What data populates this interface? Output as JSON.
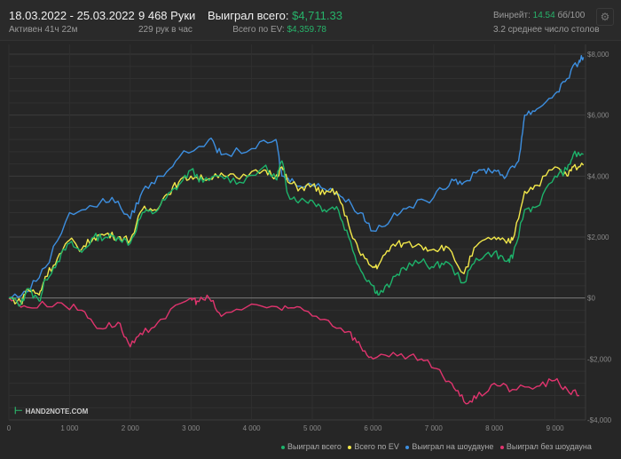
{
  "header": {
    "date_range": "18.03.2022 - 25.03.2022",
    "active": "Активен 41ч 22м",
    "hands": "9 468 Руки",
    "hands_per_hour": "229 рук в час",
    "won_label": "Выиграл всего:",
    "won_value": "$4,711.33",
    "ev_label": "Всего по EV:",
    "ev_value": "$4,359.78",
    "winrate_label": "Винрейт:",
    "winrate_value": "14.54",
    "winrate_unit": "бб/100",
    "avg_tables": "3.2 среднее число столов",
    "settings_icon": "gear-icon"
  },
  "logo": "HAND2NOTE.COM",
  "chart_data": {
    "type": "line",
    "title": "",
    "xlabel": "",
    "ylabel": "",
    "xlim": [
      0,
      9468
    ],
    "ylim": [
      -4000,
      8000
    ],
    "x_ticks": [
      0,
      1000,
      2000,
      3000,
      4000,
      5000,
      6000,
      7000,
      8000,
      9000
    ],
    "x_tick_labels": [
      "0",
      "1 000",
      "2 000",
      "3 000",
      "4 000",
      "5 000",
      "6 000",
      "7 000",
      "8 000",
      "9 000"
    ],
    "y_ticks": [
      8000,
      6000,
      4000,
      2000,
      0,
      -2000,
      -4000
    ],
    "y_tick_labels": [
      "$8,000",
      "$6,000",
      "$4,000",
      "$2,000",
      "$0",
      "-$2,000",
      "-$4,000"
    ],
    "grid": true,
    "legend_position": "bottom-right",
    "series": [
      {
        "name": "Выиграл всего",
        "color": "#1db36b",
        "points": [
          [
            0,
            0
          ],
          [
            200,
            -200
          ],
          [
            300,
            300
          ],
          [
            500,
            -100
          ],
          [
            600,
            600
          ],
          [
            800,
            1200
          ],
          [
            1000,
            1800
          ],
          [
            1200,
            1500
          ],
          [
            1400,
            2000
          ],
          [
            1600,
            2000
          ],
          [
            1800,
            2000
          ],
          [
            2000,
            1800
          ],
          [
            2200,
            2800
          ],
          [
            2400,
            2800
          ],
          [
            2600,
            3300
          ],
          [
            2800,
            3700
          ],
          [
            3000,
            4200
          ],
          [
            3200,
            3800
          ],
          [
            3500,
            4000
          ],
          [
            3800,
            3800
          ],
          [
            4200,
            4300
          ],
          [
            4400,
            3900
          ],
          [
            4500,
            4500
          ],
          [
            4600,
            3400
          ],
          [
            4800,
            3200
          ],
          [
            5000,
            3200
          ],
          [
            5200,
            2900
          ],
          [
            5400,
            3000
          ],
          [
            5600,
            2000
          ],
          [
            5800,
            900
          ],
          [
            6000,
            400
          ],
          [
            6100,
            100
          ],
          [
            6300,
            500
          ],
          [
            6500,
            1000
          ],
          [
            6800,
            1200
          ],
          [
            7000,
            1000
          ],
          [
            7200,
            1200
          ],
          [
            7500,
            500
          ],
          [
            7700,
            1300
          ],
          [
            8000,
            1500
          ],
          [
            8200,
            1200
          ],
          [
            8300,
            1300
          ],
          [
            8500,
            2900
          ],
          [
            8700,
            3000
          ],
          [
            9000,
            4000
          ],
          [
            9200,
            4200
          ],
          [
            9300,
            4700
          ],
          [
            9468,
            4711
          ]
        ]
      },
      {
        "name": "Всего по EV",
        "color": "#f2e84a",
        "points": [
          [
            0,
            0
          ],
          [
            200,
            -150
          ],
          [
            300,
            300
          ],
          [
            500,
            100
          ],
          [
            600,
            700
          ],
          [
            800,
            1300
          ],
          [
            1000,
            1900
          ],
          [
            1200,
            1600
          ],
          [
            1400,
            2000
          ],
          [
            1600,
            2100
          ],
          [
            1800,
            2000
          ],
          [
            2000,
            1900
          ],
          [
            2200,
            2900
          ],
          [
            2400,
            2900
          ],
          [
            2600,
            3400
          ],
          [
            2800,
            3800
          ],
          [
            3000,
            4000
          ],
          [
            3200,
            3900
          ],
          [
            3500,
            4100
          ],
          [
            3800,
            3900
          ],
          [
            4200,
            4200
          ],
          [
            4400,
            4000
          ],
          [
            4500,
            4300
          ],
          [
            4600,
            3800
          ],
          [
            4800,
            3600
          ],
          [
            5000,
            3700
          ],
          [
            5200,
            3400
          ],
          [
            5400,
            3500
          ],
          [
            5600,
            2400
          ],
          [
            5800,
            1400
          ],
          [
            6000,
            1000
          ],
          [
            6100,
            1100
          ],
          [
            6300,
            1700
          ],
          [
            6500,
            1800
          ],
          [
            6800,
            1700
          ],
          [
            7000,
            1600
          ],
          [
            7200,
            1700
          ],
          [
            7500,
            800
          ],
          [
            7700,
            1700
          ],
          [
            8000,
            2000
          ],
          [
            8200,
            1800
          ],
          [
            8300,
            1900
          ],
          [
            8500,
            3500
          ],
          [
            8700,
            3700
          ],
          [
            9000,
            4300
          ],
          [
            9200,
            4000
          ],
          [
            9300,
            4300
          ],
          [
            9468,
            4360
          ]
        ]
      },
      {
        "name": "Выиграл на шоудауне",
        "color": "#3d8fe0",
        "points": [
          [
            0,
            0
          ],
          [
            300,
            200
          ],
          [
            600,
            1000
          ],
          [
            1000,
            2800
          ],
          [
            1400,
            3000
          ],
          [
            1700,
            3300
          ],
          [
            2000,
            2600
          ],
          [
            2200,
            3500
          ],
          [
            2500,
            4000
          ],
          [
            2800,
            4600
          ],
          [
            3300,
            5200
          ],
          [
            3500,
            4700
          ],
          [
            4000,
            4900
          ],
          [
            4400,
            5200
          ],
          [
            4500,
            4000
          ],
          [
            4700,
            3800
          ],
          [
            5000,
            3700
          ],
          [
            5300,
            3600
          ],
          [
            5500,
            3300
          ],
          [
            5800,
            2800
          ],
          [
            6000,
            2200
          ],
          [
            6300,
            2600
          ],
          [
            6600,
            3000
          ],
          [
            7000,
            3300
          ],
          [
            7300,
            3900
          ],
          [
            7500,
            3800
          ],
          [
            7800,
            4200
          ],
          [
            8000,
            4200
          ],
          [
            8200,
            4000
          ],
          [
            8400,
            4500
          ],
          [
            8500,
            6000
          ],
          [
            8700,
            6200
          ],
          [
            9000,
            6700
          ],
          [
            9200,
            7200
          ],
          [
            9400,
            7800
          ],
          [
            9468,
            7900
          ]
        ]
      },
      {
        "name": "Выиграл без шоудауна",
        "color": "#e0346e",
        "points": [
          [
            0,
            0
          ],
          [
            300,
            -300
          ],
          [
            800,
            -150
          ],
          [
            1200,
            -400
          ],
          [
            1500,
            -1000
          ],
          [
            1800,
            -800
          ],
          [
            2000,
            -1600
          ],
          [
            2200,
            -1200
          ],
          [
            2500,
            -700
          ],
          [
            3000,
            0
          ],
          [
            3100,
            -100
          ],
          [
            3300,
            0
          ],
          [
            3500,
            -600
          ],
          [
            4000,
            -200
          ],
          [
            4500,
            -400
          ],
          [
            4800,
            -300
          ],
          [
            5200,
            -700
          ],
          [
            5600,
            -1100
          ],
          [
            5800,
            -1600
          ],
          [
            6000,
            -2000
          ],
          [
            6400,
            -1900
          ],
          [
            6800,
            -2000
          ],
          [
            7000,
            -2300
          ],
          [
            7300,
            -2800
          ],
          [
            7500,
            -3400
          ],
          [
            7700,
            -3300
          ],
          [
            8000,
            -2800
          ],
          [
            8300,
            -3000
          ],
          [
            8700,
            -2900
          ],
          [
            9000,
            -2700
          ],
          [
            9200,
            -3000
          ],
          [
            9400,
            -3200
          ]
        ]
      }
    ]
  }
}
